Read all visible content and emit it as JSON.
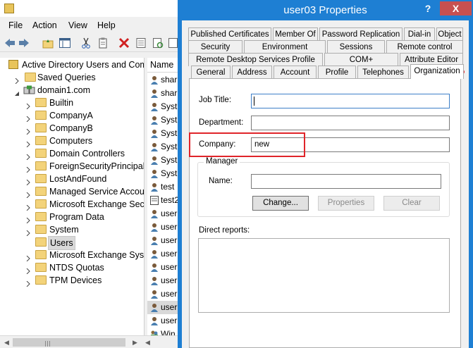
{
  "aduc": {
    "menu": [
      "File",
      "Action",
      "View",
      "Help"
    ],
    "tree": {
      "root": "Active Directory Users and Com",
      "saved_queries": "Saved Queries",
      "domain": "domain1.com",
      "containers": [
        "Builtin",
        "CompanyA",
        "CompanyB",
        "Computers",
        "Domain Controllers",
        "ForeignSecurityPrincipals",
        "LostAndFound",
        "Managed Service Accour",
        "Microsoft Exchange Secu",
        "Program Data",
        "System",
        "Users",
        "Microsoft Exchange Syste",
        "NTDS Quotas",
        "TPM Devices"
      ],
      "selected": "Users"
    },
    "list": {
      "header": "Name",
      "rows": [
        "shar",
        "shar",
        "Syst",
        "Syst",
        "Syst",
        "Syst",
        "Syst",
        "Syst",
        "test",
        "test2",
        "user",
        "user",
        "user",
        "user",
        "user",
        "user",
        "user",
        "user",
        "user",
        "Win"
      ],
      "selected_index": 17
    }
  },
  "dialog": {
    "title": "user03 Properties",
    "help": "?",
    "close": "X",
    "tabs_row1": [
      "Published Certificates",
      "Member Of",
      "Password Replication",
      "Dial-in",
      "Object"
    ],
    "tabs_row2": [
      "Security",
      "Environment",
      "Sessions",
      "Remote control"
    ],
    "tabs_row3": [
      "Remote Desktop Services Profile",
      "COM+",
      "Attribute Editor"
    ],
    "tabs_row4": [
      "General",
      "Address",
      "Account",
      "Profile",
      "Telephones",
      "Organization"
    ],
    "active_tab": "Organization",
    "fields": {
      "job_title_label": "Job Title:",
      "job_title_value": "",
      "department_label": "Department:",
      "department_value": "",
      "company_label": "Company:",
      "company_value": "new"
    },
    "manager": {
      "group_label": "Manager",
      "name_label": "Name:",
      "name_value": "",
      "change_button": "Change...",
      "properties_button": "Properties",
      "clear_button": "Clear"
    },
    "direct_reports_label": "Direct reports:",
    "annotation_color": "#e0242a"
  }
}
